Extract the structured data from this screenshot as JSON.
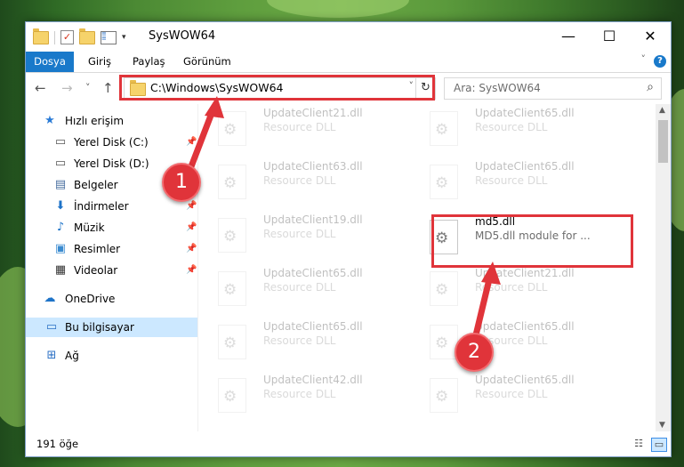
{
  "window": {
    "title": "SysWOW64"
  },
  "titlebar": {
    "minimize": "—",
    "maximize": "☐",
    "close": "✕"
  },
  "ribbon": {
    "tabs": [
      "Dosya",
      "Giriş",
      "Paylaş",
      "Görünüm"
    ],
    "help": "?"
  },
  "navigation": {
    "back": "←",
    "forward": "→",
    "recent": "˅",
    "up": "↑"
  },
  "address": {
    "path": "C:\\Windows\\SysWOW64",
    "dropdown": "˅",
    "refresh": "↻"
  },
  "search": {
    "placeholder": "Ara: SysWOW64",
    "icon": "search-icon"
  },
  "sidebar": {
    "items": [
      {
        "label": "Hızlı erişim",
        "icon": "star-icon"
      },
      {
        "label": "Yerel Disk (C:)",
        "icon": "drive-icon",
        "pinned": true
      },
      {
        "label": "Yerel Disk (D:)",
        "icon": "drive-icon",
        "pinned": false
      },
      {
        "label": "Belgeler",
        "icon": "documents-icon",
        "pinned": true
      },
      {
        "label": "İndirmeler",
        "icon": "downloads-icon",
        "pinned": true
      },
      {
        "label": "Müzik",
        "icon": "music-icon",
        "pinned": true
      },
      {
        "label": "Resimler",
        "icon": "pictures-icon",
        "pinned": true
      },
      {
        "label": "Videolar",
        "icon": "videos-icon",
        "pinned": true
      },
      {
        "label": "OneDrive",
        "icon": "cloud-icon"
      },
      {
        "label": "Bu bilgisayar",
        "icon": "computer-icon",
        "selected": true
      },
      {
        "label": "Ağ",
        "icon": "network-icon"
      }
    ]
  },
  "files": [
    {
      "name": "UpdateClient21.dll",
      "desc": "Resource DLL",
      "faded": true
    },
    {
      "name": "UpdateClient65.dll",
      "desc": "Resource DLL",
      "faded": true
    },
    {
      "name": "UpdateClient63.dll",
      "desc": "Resource DLL",
      "faded": true
    },
    {
      "name": "UpdateClient65.dll",
      "desc": "Resource DLL",
      "faded": true
    },
    {
      "name": "UpdateClient19.dll",
      "desc": "Resource DLL",
      "faded": true
    },
    {
      "name": "md5.dll",
      "desc": "MD5.dll module for ...",
      "faded": false
    },
    {
      "name": "UpdateClient65.dll",
      "desc": "Resource DLL",
      "faded": true
    },
    {
      "name": "UpdateClient21.dll",
      "desc": "Resource DLL",
      "faded": true
    },
    {
      "name": "UpdateClient65.dll",
      "desc": "Resource DLL",
      "faded": true
    },
    {
      "name": "UpdateClient65.dll",
      "desc": "Resource DLL",
      "faded": true
    },
    {
      "name": "UpdateClient42.dll",
      "desc": "Resource DLL",
      "faded": true
    },
    {
      "name": "UpdateClient65.dll",
      "desc": "Resource DLL",
      "faded": true
    }
  ],
  "status": {
    "count": "191 öğe"
  },
  "annotations": {
    "step1": "1",
    "step2": "2",
    "color": "#e0343a"
  }
}
